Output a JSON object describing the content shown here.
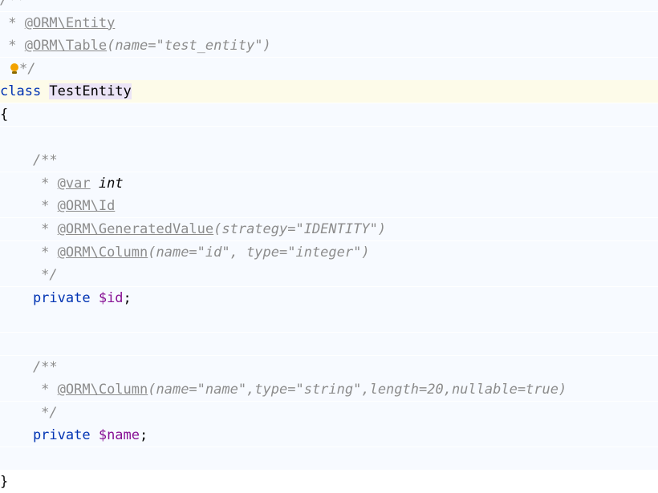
{
  "editor": {
    "lines": [
      {
        "tokens": [
          {
            "text": "/**",
            "kind": "c"
          }
        ]
      },
      {
        "tokens": [
          {
            "text": " * ",
            "kind": "c"
          },
          {
            "text": "@ORM\\Entity",
            "kind": "tag"
          }
        ]
      },
      {
        "tokens": [
          {
            "text": " * ",
            "kind": "c"
          },
          {
            "text": "@ORM\\Table",
            "kind": "tag"
          },
          {
            "text": "(name=\"test_entity\")",
            "kind": "c"
          }
        ]
      },
      {
        "tokens": [
          {
            "text": "*/",
            "kind": "c"
          }
        ],
        "bulb": true
      },
      {
        "tokens": [
          {
            "text": "class ",
            "kind": "kw"
          },
          {
            "text": "TestEntity",
            "kind": "hl"
          }
        ],
        "style": "caret"
      },
      {
        "tokens": [
          {
            "text": "{",
            "kind": "txt"
          }
        ]
      },
      {
        "tokens": []
      },
      {
        "tokens": [
          {
            "text": "    /**",
            "kind": "c"
          }
        ]
      },
      {
        "tokens": [
          {
            "text": "     * ",
            "kind": "c"
          },
          {
            "text": "@var",
            "kind": "tag"
          },
          {
            "text": " ",
            "kind": "c"
          },
          {
            "text": "int",
            "kind": "type"
          }
        ]
      },
      {
        "tokens": [
          {
            "text": "     * ",
            "kind": "c"
          },
          {
            "text": "@ORM\\Id",
            "kind": "tag"
          }
        ]
      },
      {
        "tokens": [
          {
            "text": "     * ",
            "kind": "c"
          },
          {
            "text": "@ORM\\GeneratedValue",
            "kind": "tag"
          },
          {
            "text": "(strategy=\"IDENTITY\")",
            "kind": "c"
          }
        ]
      },
      {
        "tokens": [
          {
            "text": "     * ",
            "kind": "c"
          },
          {
            "text": "@ORM\\Column",
            "kind": "tag"
          },
          {
            "text": "(name=\"id\", type=\"integer\")",
            "kind": "c"
          }
        ]
      },
      {
        "tokens": [
          {
            "text": "     */",
            "kind": "c"
          }
        ]
      },
      {
        "tokens": [
          {
            "text": "    private ",
            "kind": "kw"
          },
          {
            "text": "$id",
            "kind": "var"
          },
          {
            "text": ";",
            "kind": "txt"
          }
        ]
      },
      {
        "tokens": []
      },
      {
        "tokens": []
      },
      {
        "tokens": [
          {
            "text": "    /**",
            "kind": "c"
          }
        ]
      },
      {
        "tokens": [
          {
            "text": "     * ",
            "kind": "c"
          },
          {
            "text": "@ORM\\Column",
            "kind": "tag"
          },
          {
            "text": "(name=\"name\",type=\"string\",length=20,nullable=true)",
            "kind": "c"
          }
        ]
      },
      {
        "tokens": [
          {
            "text": "     */",
            "kind": "c"
          }
        ]
      },
      {
        "tokens": [
          {
            "text": "    private ",
            "kind": "kw"
          },
          {
            "text": "$name",
            "kind": "var"
          },
          {
            "text": ";",
            "kind": "txt"
          }
        ]
      },
      {
        "tokens": []
      },
      {
        "tokens": [
          {
            "text": "}",
            "kind": "txt"
          }
        ],
        "style": "white"
      }
    ]
  }
}
